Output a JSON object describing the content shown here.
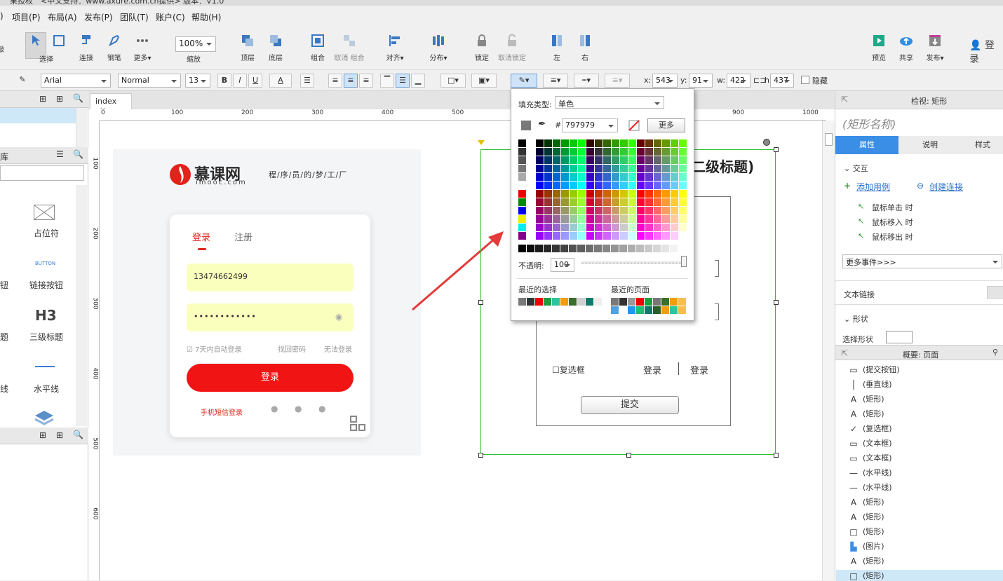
{
  "titlebar": {
    "text1": "果授权",
    "text2": "<中文支持：www.axure.com.cn提供> 版本：V1.0"
  },
  "menu": [
    "项目(P)",
    "布局(A)",
    "发布(P)",
    "团队(T)",
    "账户(C)",
    "帮助(H)"
  ],
  "menu_partial": ")",
  "toolbar": {
    "left_partial": [
      "",
      "敲"
    ],
    "items": [
      {
        "label": "选择",
        "icon": "select-icon"
      },
      {
        "label": "连接",
        "icon": "connect-icon"
      },
      {
        "label": "钢笔",
        "icon": "pen-icon"
      },
      {
        "label": "更多▾",
        "icon": "more-icon"
      },
      {
        "label": "缩放",
        "icon": "zoom-icon"
      },
      {
        "label": "顶层",
        "icon": "bring-front-icon"
      },
      {
        "label": "底层",
        "icon": "send-back-icon"
      },
      {
        "label": "组合",
        "icon": "group-icon"
      },
      {
        "label": "取消 组合",
        "icon": "ungroup-icon"
      },
      {
        "label": "对齐▾",
        "icon": "align-icon"
      },
      {
        "label": "分布▾",
        "icon": "distribute-icon"
      },
      {
        "label": "锁定",
        "icon": "lock-icon"
      },
      {
        "label": "取消锁定",
        "icon": "unlock-icon"
      },
      {
        "label": "左",
        "icon": "left-icon"
      },
      {
        "label": "右",
        "icon": "right-icon"
      },
      {
        "label": "预览",
        "icon": "preview-icon"
      },
      {
        "label": "共享",
        "icon": "share-icon"
      },
      {
        "label": "发布▾",
        "icon": "publish-icon"
      }
    ],
    "zoom": "100%",
    "login": "登录"
  },
  "format": {
    "font": "Arial",
    "weight": "Normal",
    "size": "13",
    "x_label": "x:",
    "x": "543",
    "y_label": "y:",
    "y": "91",
    "w_label": "w:",
    "w": "422",
    "h_label": "h:",
    "h": "437",
    "hide": "隐藏",
    "bold": "B",
    "italic": "I",
    "underline": "U",
    "textcolor": "A"
  },
  "leftpanel": {
    "lib_label": "库",
    "widgets": [
      {
        "label": "占位符"
      },
      {
        "label": "链接按钮",
        "mini": "BUTTON"
      },
      {
        "label": "三级标题",
        "mini": "H3"
      },
      {
        "label": "水平线"
      }
    ],
    "partial_labels": [
      "钮",
      "题",
      "线"
    ]
  },
  "canvas": {
    "tab": "index",
    "ruler_h": [
      "0",
      "100",
      "200",
      "300",
      "400",
      "500",
      "600",
      "700",
      "800",
      "900",
      "1000"
    ],
    "ruler_v": [
      "100",
      "200",
      "300",
      "400",
      "500",
      "600"
    ]
  },
  "login": {
    "brand": "慕课网",
    "brand_sub": "imooc.com",
    "slogan": "程/序/员/的/梦/工/厂",
    "tab_login": "登录",
    "tab_register": "注册",
    "phone": "13474662499",
    "password": "••••••••••••",
    "auto": "7天内自动登录",
    "forgot": "找回密码",
    "cant": "无法登录",
    "button": "登录",
    "sms": "手机短信登录"
  },
  "wireframe": {
    "heading": "二级标题)",
    "checkbox": "复选框",
    "link1": "登录",
    "link2": "登录",
    "submit": "提交"
  },
  "picker": {
    "fill_type_label": "填充类型:",
    "fill_type": "单色",
    "hash": "#",
    "hex": "797979",
    "more": "更多",
    "opacity_label": "不透明:",
    "opacity": "100",
    "recent": "最近的选择",
    "recent_page": "最近的页面"
  },
  "right": {
    "header": "检视: 矩形",
    "name_placeholder": "(矩形名称)",
    "tabs": [
      "属性",
      "说明",
      "样式"
    ],
    "interaction": "交互",
    "add_case": "添加用例",
    "create_link": "创建连接",
    "events": [
      "鼠标单击 时",
      "鼠标移入 时",
      "鼠标移出 时"
    ],
    "more_events": "更多事件>>>",
    "text_link": "文本链接",
    "shape": "形状",
    "select_shape": "选择形状",
    "outline_header": "概要: 页面",
    "outline": [
      {
        "icon": "rounded-rect-icon",
        "label": "(提交按钮)"
      },
      {
        "icon": "vertical-line-icon",
        "label": "(垂直线)"
      },
      {
        "icon": "text-a-icon",
        "label": "(矩形)"
      },
      {
        "icon": "text-a-icon",
        "label": "(矩形)"
      },
      {
        "icon": "checkmark-icon",
        "label": "(复选框)"
      },
      {
        "icon": "textbox-icon",
        "label": "(文本框)"
      },
      {
        "icon": "textbox-icon",
        "label": "(文本框)"
      },
      {
        "icon": "horizontal-line-icon",
        "label": "(水平线)"
      },
      {
        "icon": "horizontal-line-icon",
        "label": "(水平线)"
      },
      {
        "icon": "text-a-icon",
        "label": "(矩形)"
      },
      {
        "icon": "text-a-icon",
        "label": "(矩形)"
      },
      {
        "icon": "rect-icon",
        "label": "(矩形)"
      },
      {
        "icon": "image-icon",
        "label": "(图片)"
      },
      {
        "icon": "text-a-icon",
        "label": "(矩形)"
      },
      {
        "icon": "rect-icon",
        "label": "(矩形)"
      }
    ]
  },
  "colors": {
    "accent": "#3a7fd5",
    "red": "#f01414",
    "selection_green": "#2fbf2f",
    "tab_blue": "#3a8ee6"
  }
}
